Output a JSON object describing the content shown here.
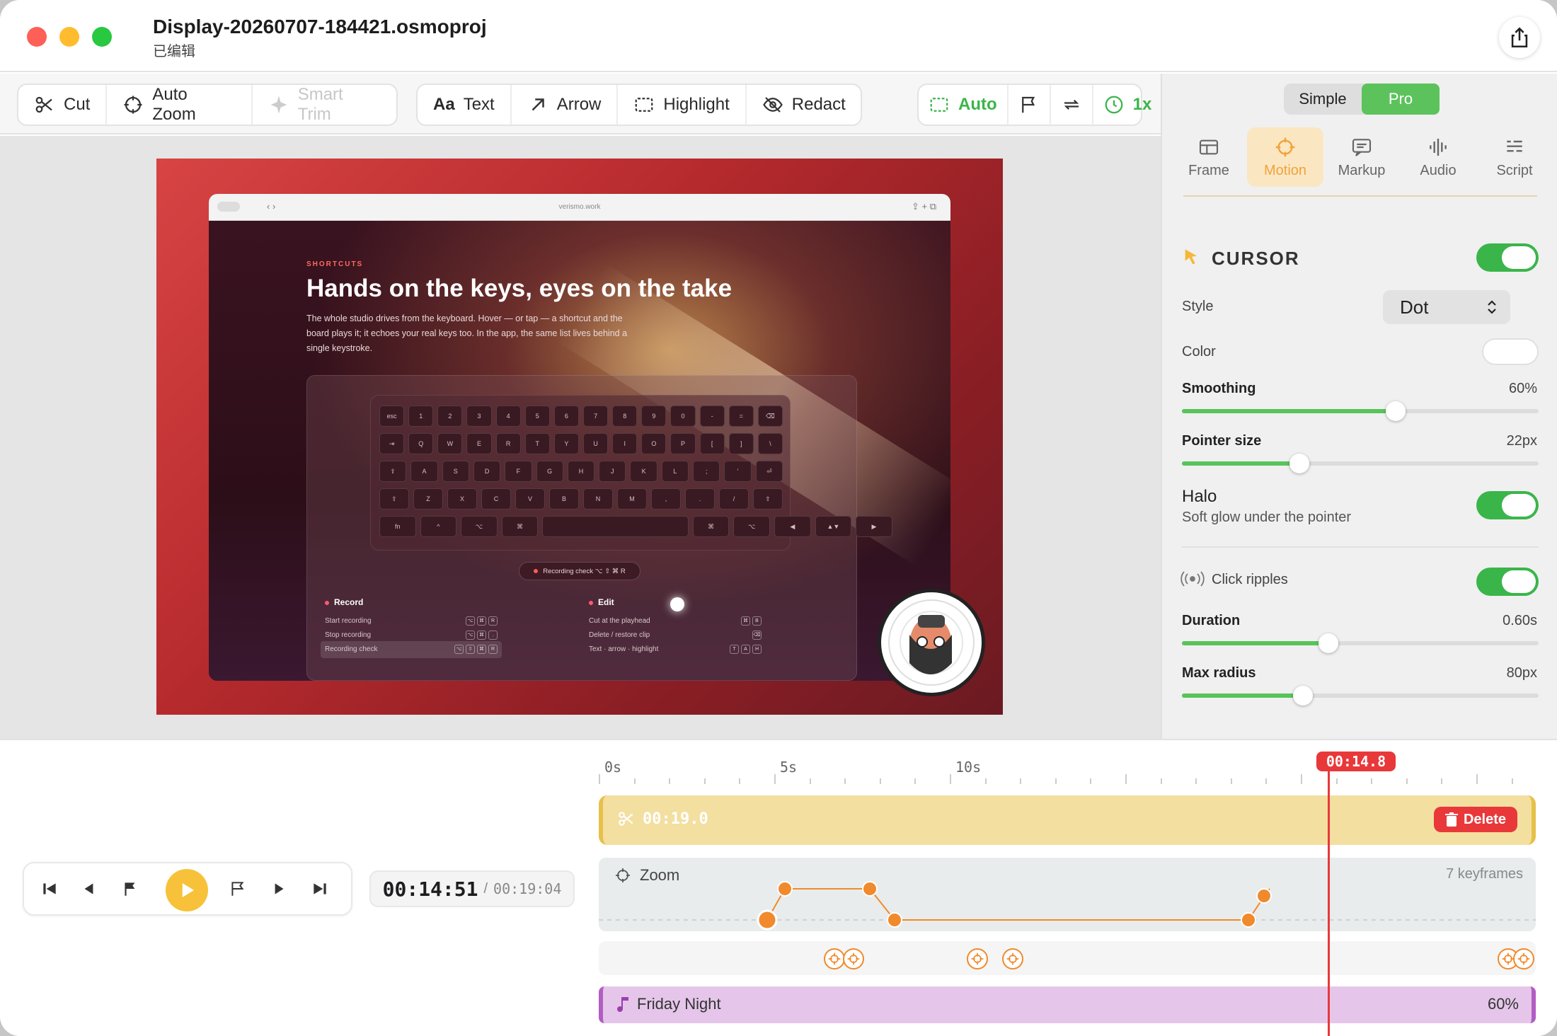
{
  "window": {
    "title": "Display-20260707-184421.osmoproj",
    "subtitle": "已编辑"
  },
  "toolbar": {
    "cut": "Cut",
    "auto_zoom": "Auto Zoom",
    "smart_trim": "Smart Trim",
    "text_prefix": "Aa",
    "text": "Text",
    "arrow": "Arrow",
    "highlight": "Highlight",
    "redact": "Redact",
    "auto": "Auto",
    "speed": "1x"
  },
  "preview": {
    "url": "verismo.work",
    "kicker": "SHORTCUTS",
    "headline": "Hands on the keys, eyes on the take",
    "paragraph": "The whole studio drives from the keyboard. Hover — or tap — a shortcut and the board plays it; it echoes your real keys too. In the app, the same list lives behind a single keystroke.",
    "keyboard_rows": [
      [
        "esc",
        "1",
        "2",
        "3",
        "4",
        "5",
        "6",
        "7",
        "8",
        "9",
        "0",
        "-",
        "=",
        "⌫"
      ],
      [
        "⇥",
        "Q",
        "W",
        "E",
        "R",
        "T",
        "Y",
        "U",
        "I",
        "O",
        "P",
        "[",
        "]",
        "\\"
      ],
      [
        "⇪",
        "A",
        "S",
        "D",
        "F",
        "G",
        "H",
        "J",
        "K",
        "L",
        ";",
        "'",
        "⏎"
      ],
      [
        "⇧",
        "Z",
        "X",
        "C",
        "V",
        "B",
        "N",
        "M",
        ",",
        ".",
        "/",
        "⇧"
      ],
      [
        "fn",
        "^",
        "⌥",
        "⌘",
        "",
        "⌘",
        "⌥",
        "◀",
        "▲▼",
        "▶"
      ]
    ],
    "recording_pill": "Recording check ⌥ ⇧ ⌘ R",
    "col_record": "Record",
    "col_edit": "Edit",
    "record_rows": [
      "Start recording",
      "Stop recording",
      "Recording check"
    ],
    "edit_rows": [
      "Cut at the playhead",
      "Delete / restore clip",
      "Text · arrow · highlight"
    ],
    "record_keys": [
      [
        "⌥",
        "⌘",
        "R"
      ],
      [
        "⌥",
        "⌘",
        "."
      ],
      [
        "⌥",
        "⇧",
        "⌘",
        "R"
      ]
    ],
    "edit_keys": [
      [
        "⌘",
        "B"
      ],
      [
        "⌫"
      ],
      [
        "T",
        "A",
        "H"
      ]
    ]
  },
  "panel": {
    "mode_simple": "Simple",
    "mode_pro": "Pro",
    "tabs": [
      "Frame",
      "Motion",
      "Markup",
      "Audio",
      "Script"
    ],
    "active_tab": "Motion",
    "cursor_title": "CURSOR",
    "style_label": "Style",
    "style_value": "Dot",
    "color_label": "Color",
    "smoothing_label": "Smoothing",
    "smoothing_value": "60%",
    "smoothing_fraction": 0.6,
    "pointer_label": "Pointer size",
    "pointer_value": "22px",
    "pointer_fraction": 0.33,
    "halo_label": "Halo",
    "halo_desc": "Soft glow under the pointer",
    "ripples_label": "Click ripples",
    "duration_label": "Duration",
    "duration_value": "0.60s",
    "duration_fraction": 0.41,
    "radius_label": "Max radius",
    "radius_value": "80px",
    "radius_fraction": 0.34,
    "accent": "#3ab54a"
  },
  "timeline": {
    "ruler": [
      "0s",
      "5s",
      "10s"
    ],
    "playhead": "00:14.8",
    "clip_duration": "00:19.0",
    "delete": "Delete",
    "current_time": "00:14:51",
    "separator": "/",
    "total_time": "00:19:04",
    "zoom_label": "Zoom",
    "zoom_count": "7 keyframes",
    "audio_name": "Friday Night",
    "audio_volume": "60%"
  }
}
